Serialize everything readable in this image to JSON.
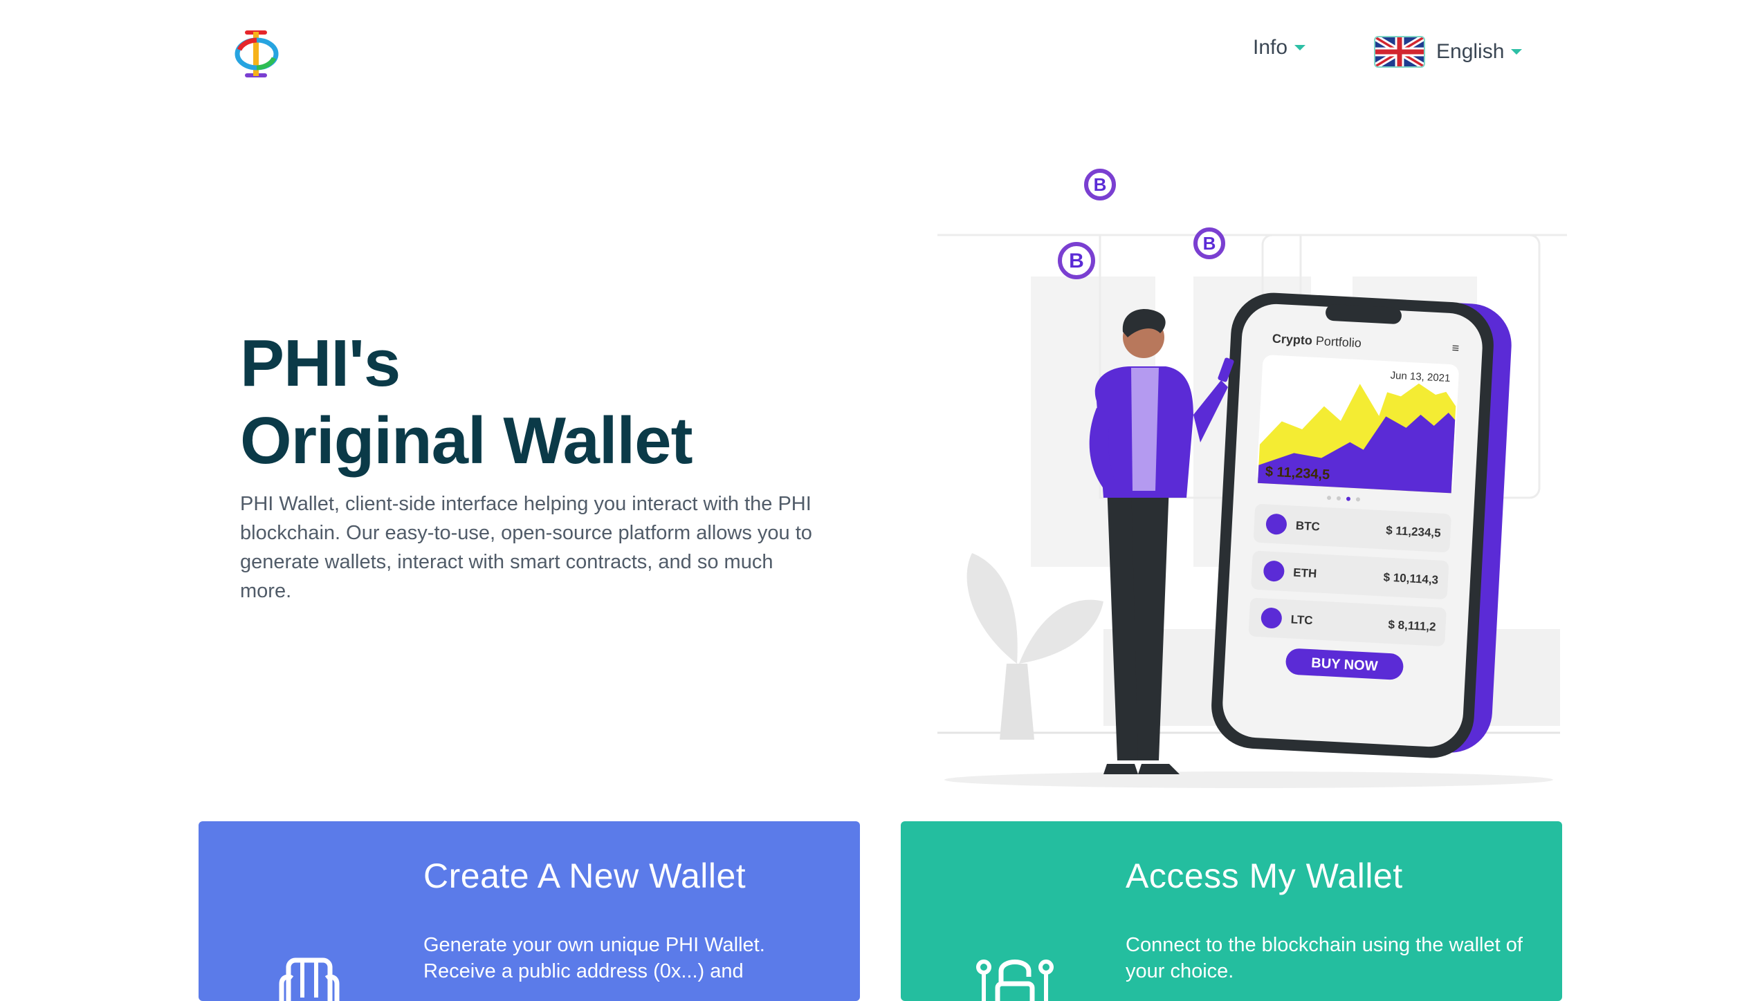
{
  "brand": {
    "logo_icon": "phi-logo-icon",
    "logo_colors": [
      "#e5262b",
      "#f6b21a",
      "#27a4e0",
      "#7a3fd1"
    ]
  },
  "nav": {
    "info_label": "Info",
    "language_label": "English",
    "language_flag_icon": "uk-flag-icon",
    "caret_color": "#2dbfa5"
  },
  "hero": {
    "title_line1": "PHI's",
    "title_line2": "Original Wallet",
    "description": "PHI Wallet, client-side interface helping you interact with the PHI blockchain. Our easy-to-use, open-source platform allows you to generate wallets, interact with smart contracts, and so much more.",
    "title_color": "#0b3a48"
  },
  "illustration": {
    "phone_title_bold": "Crypto",
    "phone_title_rest": " Portfolio",
    "date": "Jun 13, 2021",
    "balance": "$ 11,234,5",
    "coins": [
      {
        "symbol": "BTC",
        "price": "$ 11,234,5",
        "icon": "bitcoin-icon"
      },
      {
        "symbol": "ETH",
        "price": "$ 10,114,3",
        "icon": "ethereum-icon"
      },
      {
        "symbol": "LTC",
        "price": "$ 8,111,2",
        "icon": "litecoin-icon"
      }
    ],
    "buy_button": "BUY NOW",
    "accent_color": "#5b2bd6",
    "highlight_color": "#f4ec33"
  },
  "cards": {
    "create": {
      "title": "Create A New Wallet",
      "text": "Generate your own unique PHI Wallet. Receive a public address (0x...) and",
      "icon": "wallet-icon",
      "color": "#5b7be9"
    },
    "access": {
      "title": "Access My Wallet",
      "text": "Connect to the blockchain using the wallet of your choice.",
      "icon": "unlock-icon",
      "color": "#24be9f"
    }
  }
}
